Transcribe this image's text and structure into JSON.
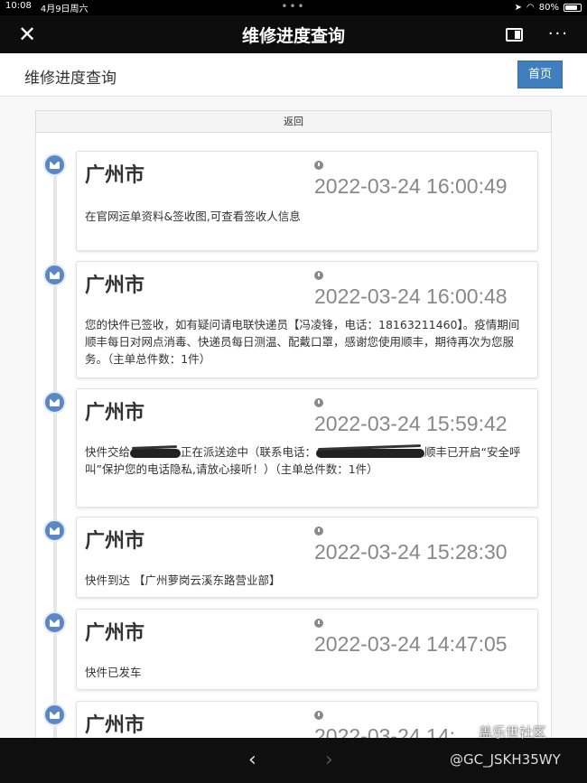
{
  "status": {
    "time": "10:08",
    "date": "4月9日周六",
    "battery": "80%",
    "battery_level": 0.8,
    "dots": "•••"
  },
  "navbar": {
    "title": "维修进度查询",
    "close_symbol": "✕",
    "more_symbol": "···"
  },
  "page": {
    "title": "维修进度查询",
    "home_label": "首页",
    "back_label": "返回"
  },
  "entries": [
    {
      "city": "广州市",
      "time": "2022-03-24 16:00:49",
      "desc": "在官网运单资料&签收图,可查看签收人信息"
    },
    {
      "city": "广州市",
      "time": "2022-03-24 16:00:48",
      "desc": "您的快件已签收，如有疑问请电联快递员【冯凌锋，电话：18163211460】。疫情期间顺丰每日对网点消毒、快递员每日测温、配戴口罩，感谢您使用顺丰，期待再次为您服务。（主单总件数：1件）"
    },
    {
      "city": "广州市",
      "time": "2022-03-24 15:59:42",
      "desc_a": "快件交给",
      "desc_b": "正在派送途中（联系电话：",
      "desc_c": "顺丰已开启“安全呼叫”保护您的电话隐私,请放心接听！）（主单总件数：1件）"
    },
    {
      "city": "广州市",
      "time": "2022-03-24 15:28:30",
      "desc": "快件到达 【广州萝岗云溪东路营业部】"
    },
    {
      "city": "广州市",
      "time": "2022-03-24 14:47:05",
      "desc": "快件已发车"
    },
    {
      "city": "广州市",
      "time": "2022-03-24 14:",
      "desc": ""
    }
  ],
  "bottom": {
    "back": "‹",
    "forward": "›"
  },
  "watermark": {
    "line1": "盖乐世社区",
    "line2": "@GC_JSKH35WY"
  },
  "colors": {
    "accent": "#3f7fc0",
    "timeline_dot": "#5b88c4"
  }
}
